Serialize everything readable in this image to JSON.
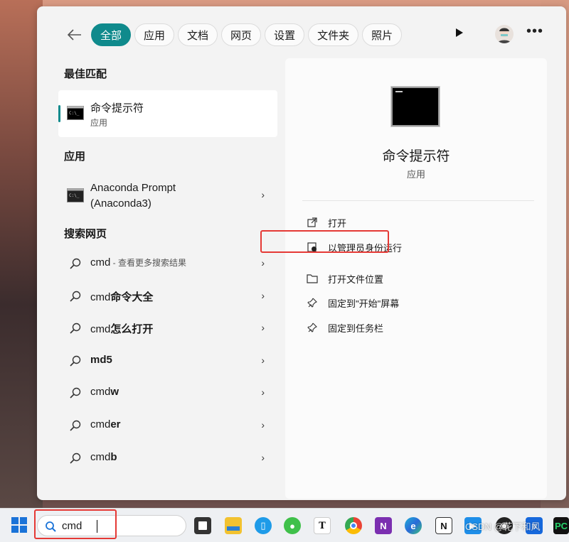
{
  "filters": [
    {
      "label": "全部",
      "active": true
    },
    {
      "label": "应用",
      "active": false
    },
    {
      "label": "文档",
      "active": false
    },
    {
      "label": "网页",
      "active": false
    },
    {
      "label": "设置",
      "active": false
    },
    {
      "label": "文件夹",
      "active": false
    },
    {
      "label": "照片",
      "active": false
    }
  ],
  "sections": {
    "best_match": "最佳匹配",
    "apps": "应用",
    "web": "搜索网页"
  },
  "best_match": {
    "name": "命令提示符",
    "type": "应用"
  },
  "apps": [
    {
      "name_line1": "Anaconda Prompt",
      "name_line2": "(Anaconda3)"
    }
  ],
  "web_results": [
    {
      "prefix": "cmd",
      "rest": "",
      "hint": " - 查看更多搜索结果"
    },
    {
      "prefix": "cmd",
      "rest": "命令大全",
      "hint": ""
    },
    {
      "prefix": "cmd",
      "rest": "怎么打开",
      "hint": ""
    },
    {
      "prefix": "",
      "rest": "md5",
      "hint": ""
    },
    {
      "prefix": "cmd",
      "rest": "w",
      "hint": ""
    },
    {
      "prefix": "cmd",
      "rest": "er",
      "hint": ""
    },
    {
      "prefix": "cmd",
      "rest": "b",
      "hint": ""
    }
  ],
  "detail": {
    "name": "命令提示符",
    "type": "应用",
    "actions": [
      {
        "label": "打开",
        "icon": "open-external-icon"
      },
      {
        "label": "以管理员身份运行",
        "icon": "shield-admin-icon"
      },
      {
        "label": "打开文件位置",
        "icon": "folder-icon"
      },
      {
        "label": "固定到\"开始\"屏幕",
        "icon": "pin-icon"
      },
      {
        "label": "固定到任务栏",
        "icon": "pin-icon"
      }
    ]
  },
  "taskbar": {
    "search_value": "cmd",
    "watermark": "CSDN @花下和风"
  },
  "colors": {
    "accent": "#0f8a8c",
    "highlight_box": "#e53935"
  }
}
